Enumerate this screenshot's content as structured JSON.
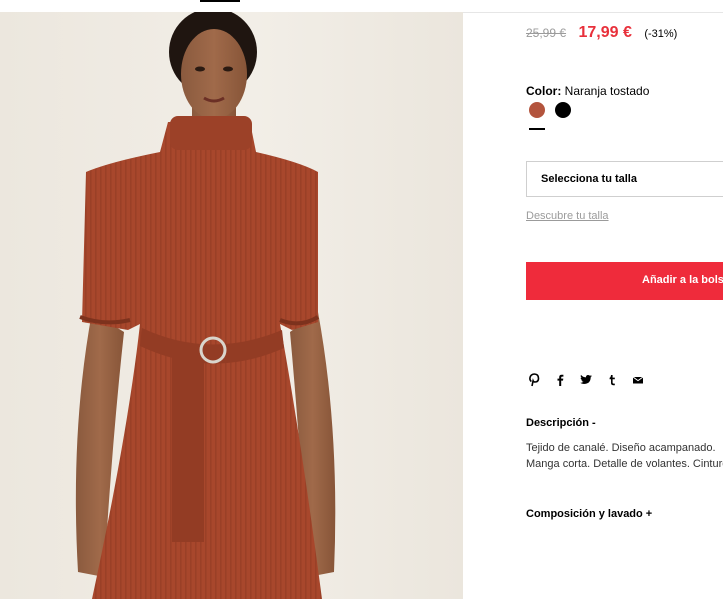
{
  "product": {
    "old_price": "25,99 €",
    "new_price": "17,99 €",
    "discount": "(-31%)",
    "color_label": "Color:",
    "color_value": "Naranja tostado",
    "swatches": [
      {
        "name": "Naranja tostado",
        "color": "#b3543d",
        "selected": true
      },
      {
        "name": "Negro",
        "color": "#000000",
        "selected": false
      }
    ],
    "size_placeholder": "Selecciona tu talla",
    "size_guide_link": "Descubre tu talla",
    "add_to_bag": "Añadir a la bolsa",
    "description_title": "Descripción -",
    "description_lines": [
      "Tejido de canalé. Diseño acampanado.",
      "Manga corta. Detalle de volantes. Cinturón."
    ],
    "composition_title": "Composición y lavado +"
  },
  "share_icons": [
    "pinterest-icon",
    "facebook-icon",
    "twitter-icon",
    "tumblr-icon",
    "email-icon"
  ],
  "colors": {
    "accent_red": "#ef2b3b",
    "price_red": "#e8303b",
    "dress": "#a8472c"
  }
}
